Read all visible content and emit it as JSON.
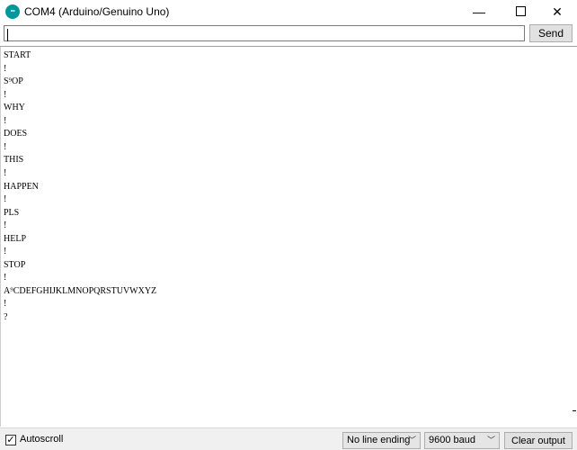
{
  "window": {
    "title": "COM4 (Arduino/Genuino Uno)",
    "icon": "arduino-icon",
    "controls": {
      "minimize": "—",
      "maximize": "□",
      "close": "✕"
    }
  },
  "input": {
    "value": "",
    "send_label": "Send"
  },
  "output": {
    "lines": [
      "START",
      "!",
      "S⁹OP",
      "!",
      "WHY",
      "!",
      "DOES",
      "!",
      "THIS",
      "!",
      "HAPPEN",
      "!",
      "PLS",
      "!",
      "HELP",
      "!",
      "STOP",
      "!",
      "A⁹CDEFGHIJKLMNOPQRSTUVWXYZ",
      "!",
      "?"
    ]
  },
  "footer": {
    "autoscroll_label": "Autoscroll",
    "autoscroll_checked": true,
    "line_ending": "No line ending",
    "baud_rate": "9600 baud",
    "clear_label": "Clear output"
  },
  "colors": {
    "arduino_teal": "#00979c"
  }
}
